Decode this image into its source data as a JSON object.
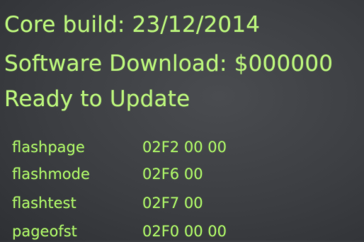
{
  "status": {
    "core_build": "Core build: 23/12/2014",
    "software_download": "Software Download: $000000",
    "ready": "Ready to Update"
  },
  "registers": [
    {
      "name": "flashpage",
      "value": "02F2 00 00"
    },
    {
      "name": "flashmode",
      "value": "02F6 00"
    },
    {
      "name": "flashtest",
      "value": "02F7 00"
    },
    {
      "name": "pageofst",
      "value": "02F0 00 00"
    }
  ],
  "colors": {
    "background": "#3c3e42",
    "text": "#b8f07a"
  }
}
